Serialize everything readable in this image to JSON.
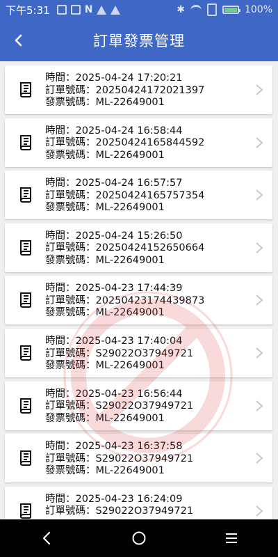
{
  "status_bar": {
    "time": "下午5:31",
    "battery_text": "100%",
    "battery_level": 1.0,
    "battery_color": "#7ee07e",
    "icons_left": [
      "image-icon",
      "pulse-icon",
      "n-icon",
      "warning-icon",
      "warning-icon"
    ],
    "icons_right": [
      "bluetooth-icon",
      "wifi-icon",
      "sim-icon",
      "battery-icon"
    ]
  },
  "header": {
    "title": "訂單發票管理",
    "back_icon": "chevron-left-icon",
    "background_color": "#3f67c6"
  },
  "orders": [
    {
      "time": "時間：2025-04-24 17:20:21",
      "order_no": "訂單號碼：20250424172021397",
      "invoice_no": "發票號碼：ML-22649001"
    },
    {
      "time": "時間：2025-04-24 16:58:44",
      "order_no": "訂單號碼：20250424165844592",
      "invoice_no": "發票號碼：ML-22649001"
    },
    {
      "time": "時間：2025-04-24 16:57:57",
      "order_no": "訂單號碼：20250424165757354",
      "invoice_no": "發票號碼：ML-22649001"
    },
    {
      "time": "時間：2025-04-24 15:26:50",
      "order_no": "訂單號碼：20250424152650664",
      "invoice_no": "發票號碼：ML-22649001"
    },
    {
      "time": "時間：2025-04-23 17:44:39",
      "order_no": "訂單號碼：20250423174439873",
      "invoice_no": "發票號碼：ML-22649001"
    },
    {
      "time": "時間：2025-04-23 17:40:04",
      "order_no": "訂單號碼：S29022O37949721",
      "invoice_no": "發票號碼：ML-22649001"
    },
    {
      "time": "時間：2025-04-23 16:56:44",
      "order_no": "訂單號碼：S29022O37949721",
      "invoice_no": "發票號碼：ML-22649001"
    },
    {
      "time": "時間：2025-04-23 16:37:58",
      "order_no": "訂單號碼：S29022O37949721",
      "invoice_no": "發票號碼：ML-22649001"
    },
    {
      "time": "時間：2025-04-23 16:24:09",
      "order_no": "訂單號碼：S29022O37949721",
      "invoice_no": ""
    }
  ],
  "watermark": {
    "text": "Don't deal / risk",
    "color": "#e23a3a"
  },
  "nav_bar": {
    "back_icon": "nav-back-icon",
    "home_icon": "nav-home-icon",
    "menu_icon": "nav-menu-icon"
  }
}
